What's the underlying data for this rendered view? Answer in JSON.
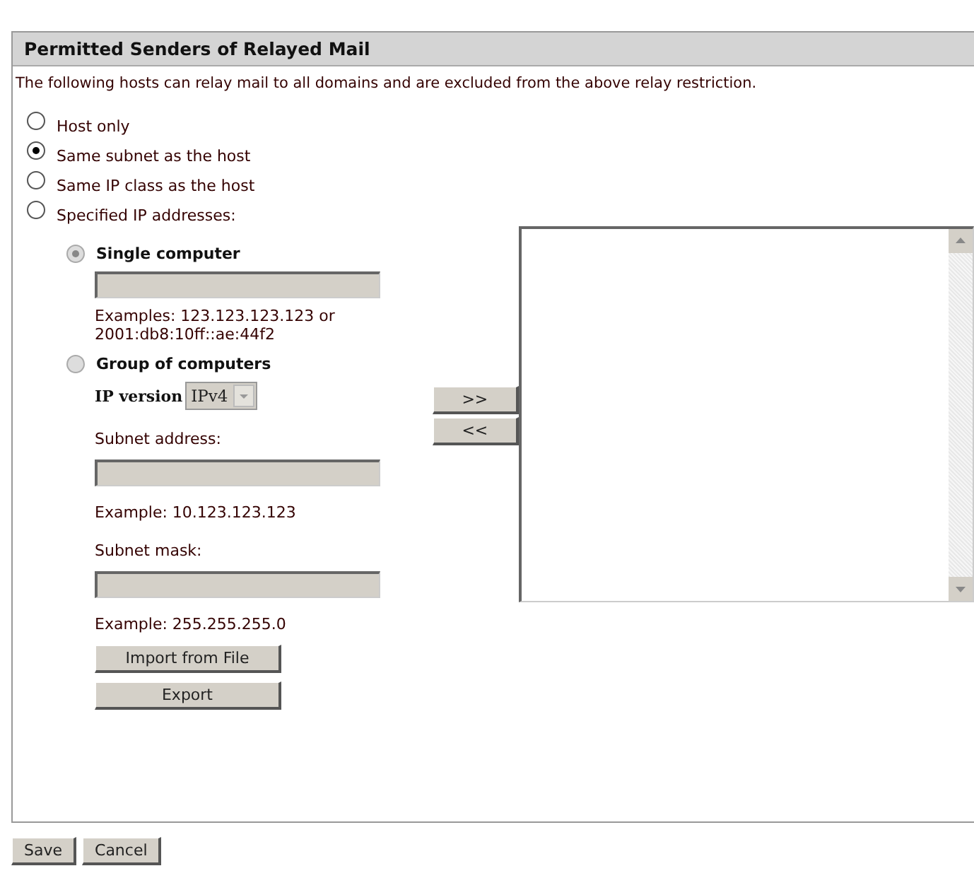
{
  "panel": {
    "title": "Permitted Senders of Relayed Mail",
    "description": "The following hosts can relay mail to all domains and are excluded from the above relay restriction."
  },
  "scope_options": [
    {
      "label": "Host only",
      "selected": false
    },
    {
      "label": "Same subnet as the host",
      "selected": true
    },
    {
      "label": "Same IP class as the host",
      "selected": false
    },
    {
      "label": "Specified IP addresses:",
      "selected": false
    }
  ],
  "single_computer": {
    "label": "Single computer",
    "selected": true,
    "disabled": true,
    "example": "Examples: 123.123.123.123 or 2001:db8:10ff::ae:44f2"
  },
  "group_of_computers": {
    "label": "Group of computers",
    "selected": false,
    "disabled": true,
    "ip_version_label": "IP version",
    "ip_version": "IPv4",
    "subnet_address_label": "Subnet address:",
    "subnet_address_example": "Example: 10.123.123.123",
    "subnet_mask_label": "Subnet mask:",
    "subnet_mask_example": "Example: 255.255.255.0"
  },
  "file_buttons": [
    "Import from File",
    "Export"
  ],
  "move_buttons": [
    ">>",
    "<<"
  ],
  "footer_buttons": [
    "Save",
    "Cancel"
  ]
}
